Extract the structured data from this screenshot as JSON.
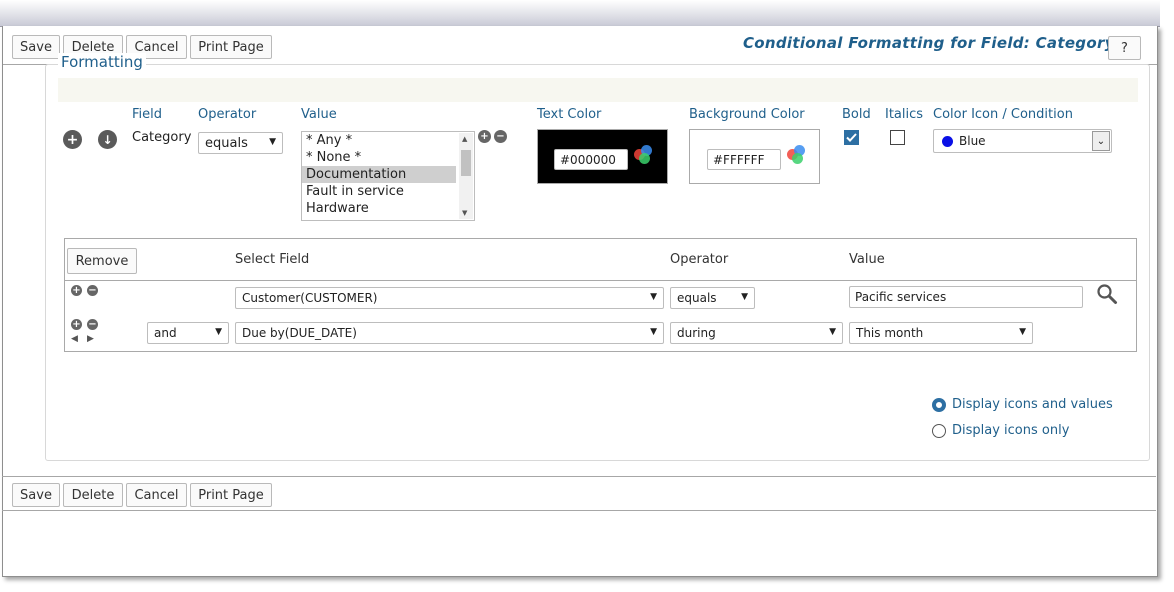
{
  "toolbar": {
    "save": "Save",
    "delete": "Delete",
    "cancel": "Cancel",
    "print": "Print Page",
    "help": "?"
  },
  "title": "Conditional Formatting for Field: Category",
  "formatting": {
    "legend": "Formatting",
    "headers": {
      "field": "Field",
      "operator": "Operator",
      "value": "Value",
      "text_color": "Text Color",
      "background_color": "Background Color",
      "bold": "Bold",
      "italics": "Italics",
      "color_icon": "Color Icon / Condition"
    },
    "field": "Category",
    "operator": "equals",
    "values": [
      "* Any *",
      "* None *",
      "Documentation",
      "Fault in service",
      "Hardware"
    ],
    "selected_value": "Documentation",
    "text_color": "#000000",
    "background_color": "#FFFFFF",
    "bold": true,
    "italics": false,
    "color_icon": {
      "label": "Blue",
      "color": "#0a10e6"
    }
  },
  "conditions": {
    "remove_label": "Remove",
    "headers": {
      "field": "Select Field",
      "operator": "Operator",
      "value": "Value"
    },
    "rows": [
      {
        "connector": "",
        "field": "Customer(CUSTOMER)",
        "operator": "equals",
        "value": "Pacific services"
      },
      {
        "connector": "and",
        "field": "Due by(DUE_DATE)",
        "operator": "during",
        "value": "This month"
      }
    ]
  },
  "display_options": {
    "icons_and_values": "Display icons and values",
    "icons_only": "Display icons only",
    "selected": "icons_and_values"
  },
  "colors": {
    "accent": "#1f5f8b",
    "radio": "#2d6fa3",
    "checkbox": "#2d6fa3"
  }
}
